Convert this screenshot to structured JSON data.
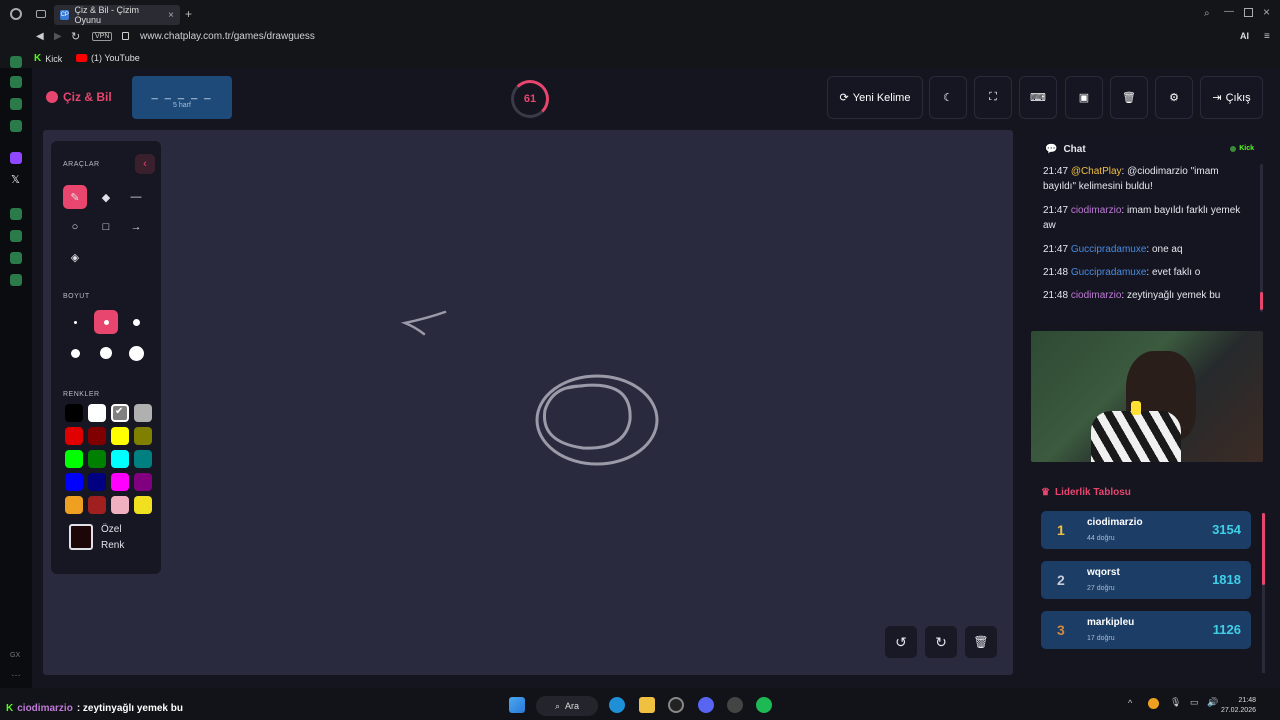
{
  "browser": {
    "tab_title": "Çiz & Bil - Çizim Oyunu",
    "tab_favicon_text": "CP",
    "vpn_label": "VPN",
    "url": "www.chatplay.com.tr/games/drawguess",
    "ai_label": "AI",
    "bookmarks": [
      {
        "label": "Kick",
        "color": "#53fc18"
      },
      {
        "label": "(1) YouTube",
        "color": "#ff0000"
      }
    ],
    "opera_gx_label": "GX"
  },
  "app": {
    "logo": "Çiz & Bil",
    "word_mask": "_ _ _ _ _",
    "word_hint": "5 harf",
    "timer": "61",
    "buttons": {
      "new_word": "Yeni Kelime",
      "exit": "Çıkış"
    },
    "accent": "#e8466e"
  },
  "tools": {
    "title": "ARAÇLAR",
    "size_title": "BOYUT",
    "colors_title": "RENKLER",
    "custom_label_1": "Özel",
    "custom_label_2": "Renk",
    "palette": [
      "#000000",
      "#ffffff",
      "#808080",
      "#b0b0b0",
      "#e00000",
      "#800000",
      "#ffff00",
      "#808000",
      "#00ff00",
      "#008000",
      "#00ffff",
      "#008080",
      "#0000ff",
      "#000080",
      "#ff00ff",
      "#800080",
      "#f0a020",
      "#a02020",
      "#f0b0c0",
      "#f0e020"
    ]
  },
  "chat": {
    "title": "Chat",
    "platform": "Kick",
    "messages": [
      {
        "time": "21:47",
        "user": "@ChatPlay",
        "user_class": "u1",
        "text": ": @ciodimarzio \"imam bayıldı\" kelimesini buldu!"
      },
      {
        "time": "21:47",
        "user": "ciodimarzio",
        "user_class": "u2",
        "text": ": imam bayıldı farklı yemek aw"
      },
      {
        "time": "21:47",
        "user": "Guccipradamuxe",
        "user_class": "u3",
        "text": ": one aq"
      },
      {
        "time": "21:48",
        "user": "Guccipradamuxe",
        "user_class": "u3",
        "text": ": evet faklı o"
      },
      {
        "time": "21:48",
        "user": "ciodimarzio",
        "user_class": "u2",
        "text": ": zeytinyağlı yemek bu"
      }
    ]
  },
  "leaderboard": {
    "title": "Liderlik Tablosu",
    "rows": [
      {
        "rank": "1",
        "name": "ciodimarzio",
        "sub": "44 doğru",
        "score": "3154",
        "rank_color": "#f0c040"
      },
      {
        "rank": "2",
        "name": "wqorst",
        "sub": "27 doğru",
        "score": "1818",
        "rank_color": "#c8ccd8"
      },
      {
        "rank": "3",
        "name": "markipleu",
        "sub": "17 doğru",
        "score": "1126",
        "rank_color": "#d08840"
      }
    ]
  },
  "taskbar": {
    "ticker_user": "ciodimarzio",
    "ticker_text": ": zeytinyağlı yemek bu",
    "search": "Ara",
    "time": "21:48",
    "date": "27.02.2026"
  }
}
